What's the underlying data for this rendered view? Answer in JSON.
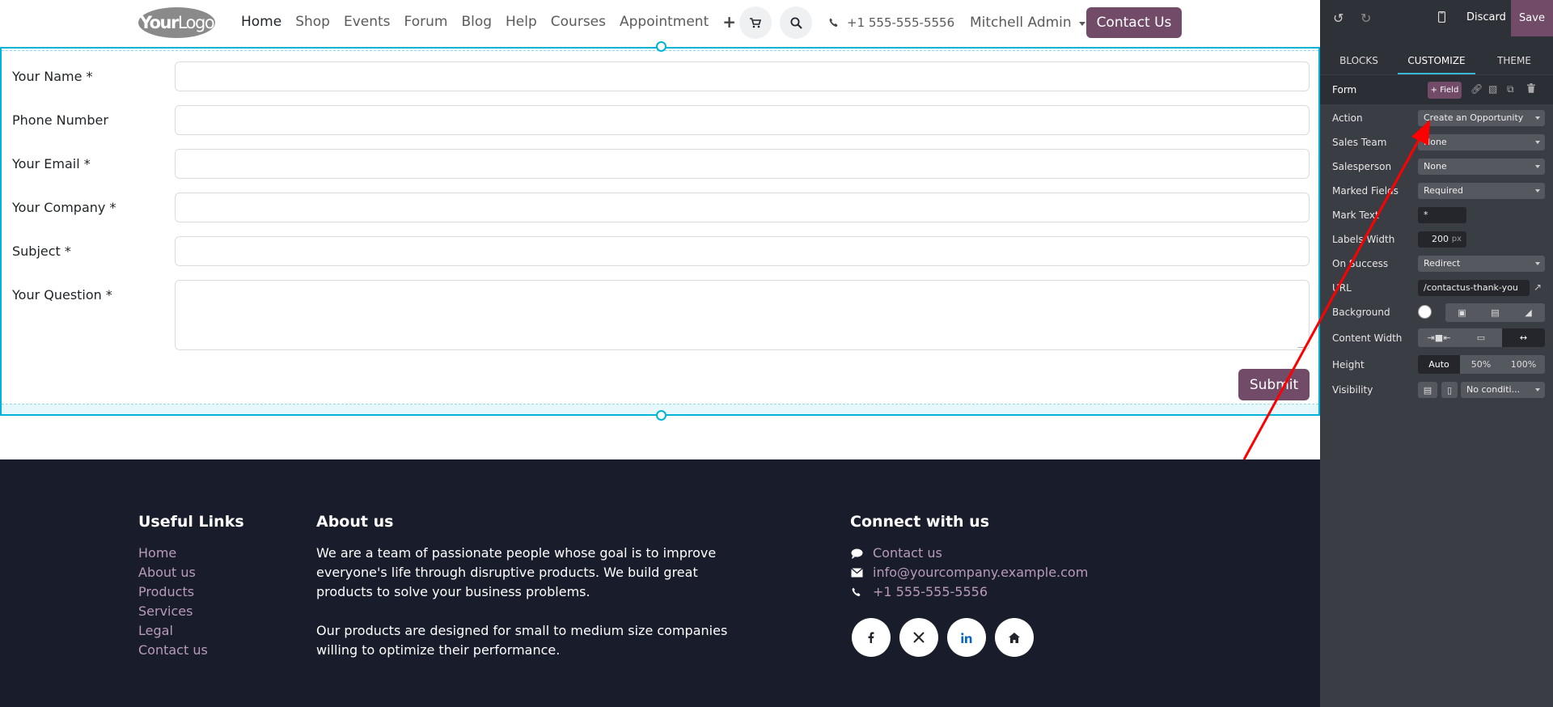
{
  "header": {
    "logo_text_a": "Your",
    "logo_text_b": "Logo",
    "nav": [
      "Home",
      "Shop",
      "Events",
      "Forum",
      "Blog",
      "Help",
      "Courses",
      "Appointment"
    ],
    "nav_add_symbol": "+",
    "phone": "+1 555-555-5556",
    "user": "Mitchell Admin",
    "contact_button": "Contact Us"
  },
  "form": {
    "fields": [
      {
        "label": "Your Name *",
        "value": ""
      },
      {
        "label": "Phone Number",
        "value": ""
      },
      {
        "label": "Your Email *",
        "value": ""
      },
      {
        "label": "Your Company *",
        "value": ""
      },
      {
        "label": "Subject *",
        "value": ""
      },
      {
        "label": "Your Question *",
        "value": ""
      }
    ],
    "submit": "Submit"
  },
  "footer": {
    "useful_links_title": "Useful Links",
    "useful_links": [
      "Home",
      "About us",
      "Products",
      "Services",
      "Legal",
      "Contact us"
    ],
    "about_title": "About us",
    "about_p1": "We are a team of passionate people whose goal is to improve everyone's life through disruptive products. We build great products to solve your business problems.",
    "about_p2": "Our products are designed for small to medium size companies willing to optimize their performance.",
    "connect_title": "Connect with us",
    "connect_contact": "Contact us",
    "connect_email": "info@yourcompany.example.com",
    "connect_phone": "+1 555-555-5556",
    "social_icons": [
      "facebook-icon",
      "x-icon",
      "linkedin-icon",
      "home-icon"
    ]
  },
  "editor": {
    "discard": "Discard",
    "save": "Save",
    "tabs": [
      "BLOCKS",
      "CUSTOMIZE",
      "THEME"
    ],
    "active_tab": "CUSTOMIZE",
    "form_title": "Form",
    "add_field": "+ Field",
    "options": {
      "action_label": "Action",
      "action_value": "Create an Opportunity",
      "sales_team_label": "Sales Team",
      "sales_team_value": "None",
      "salesperson_label": "Salesperson",
      "salesperson_value": "None",
      "marked_fields_label": "Marked Fields",
      "marked_fields_value": "Required",
      "mark_text_label": "Mark Text",
      "mark_text_value": "*",
      "labels_width_label": "Labels Width",
      "labels_width_value": "200",
      "labels_width_unit": "px",
      "on_success_label": "On Success",
      "on_success_value": "Redirect",
      "url_label": "URL",
      "url_value": "/contactus-thank-you",
      "background_label": "Background",
      "content_width_label": "Content Width",
      "height_label": "Height",
      "height_options": [
        "Auto",
        "50%",
        "100%"
      ],
      "height_selected": "Auto",
      "visibility_label": "Visibility",
      "visibility_value": "No conditi..."
    }
  },
  "colors": {
    "brand": "#714b67",
    "selection": "#00b4d8",
    "footer_bg": "#191c2b",
    "annotation": "#ff0000"
  }
}
